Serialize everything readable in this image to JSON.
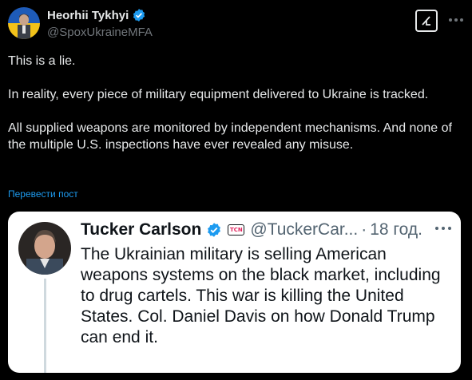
{
  "author": {
    "name": "Heorhii Tykhyi",
    "handle": "@SpoxUkraineMFA"
  },
  "post": {
    "paragraphs": [
      "This is a lie.",
      "In reality, every piece of military equipment delivered to Ukraine is tracked.",
      "All supplied weapons are monitored by independent mechanisms. And none of the multiple U.S. inspections have ever revealed any misuse."
    ],
    "translate_label": "Перевести пост"
  },
  "quoted": {
    "name": "Tucker Carlson",
    "badge": "TCN",
    "handle": "@TuckerCar...",
    "separator": "·",
    "time": "18 год.",
    "text": "The Ukrainian military is selling American weapons systems on the black market, including to drug cartels. This war is killing the United States. Col. Daniel Davis on how Donald Trump can end it."
  },
  "colors": {
    "background": "#000000",
    "text": "#e7e9ea",
    "muted": "#71767b",
    "link": "#1d9bf0",
    "verified": "#1d9bf0"
  },
  "icons": {
    "verified": "verified-badge-icon",
    "grok": "grok-icon",
    "more": "more-dots-icon"
  }
}
